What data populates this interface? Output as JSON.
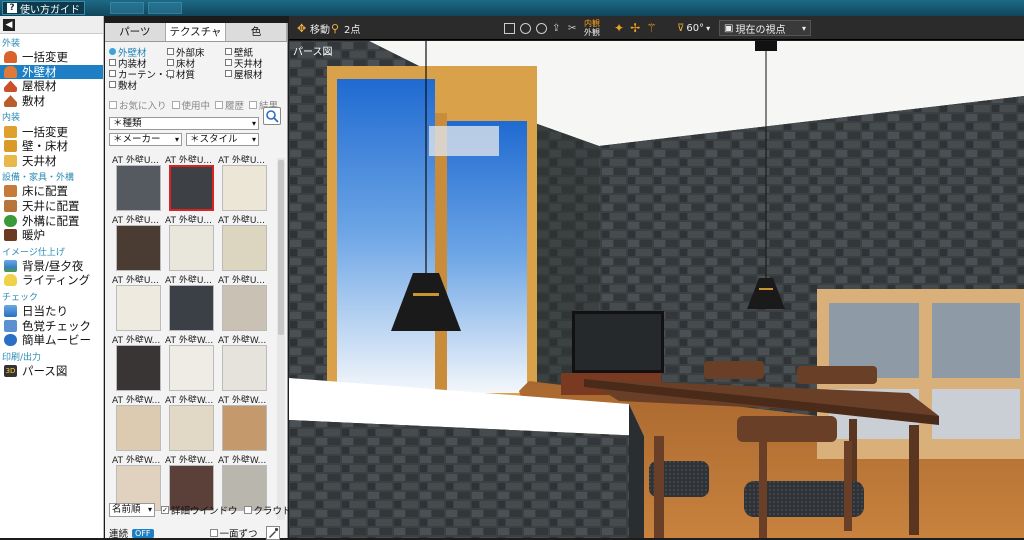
{
  "titlebar": {
    "guide_button": "使い方ガイド"
  },
  "sidebar": {
    "sections": {
      "exterior": "外装",
      "interior": "内装",
      "equipment": "設備・家具・外構",
      "image_finish": "イメージ仕上げ",
      "check": "チェック",
      "print": "印刷/出力"
    },
    "items": [
      {
        "label": "一括変更",
        "icon": "house-bulk-icon",
        "color": "#d9632b"
      },
      {
        "label": "外壁材",
        "icon": "exterior-wall-icon",
        "color": "#d9632b"
      },
      {
        "label": "屋根材",
        "icon": "roof-icon",
        "color": "#d9632b"
      },
      {
        "label": "敷材",
        "icon": "ground-material-icon",
        "color": "#d9632b"
      },
      {
        "label": "一括変更",
        "icon": "interior-bulk-icon",
        "color": "#e0a030"
      },
      {
        "label": "壁・床材",
        "icon": "wall-floor-icon",
        "color": "#e0a030"
      },
      {
        "label": "天井材",
        "icon": "ceiling-icon",
        "color": "#e0a030"
      },
      {
        "label": "床に配置",
        "icon": "chair-icon",
        "color": "#c77b3a"
      },
      {
        "label": "天井に配置",
        "icon": "lamp-icon",
        "color": "#c77b3a"
      },
      {
        "label": "外構に配置",
        "icon": "tree-icon",
        "color": "#3a9a3a"
      },
      {
        "label": "暖炉",
        "icon": "fireplace-icon",
        "color": "#8a4a2a"
      },
      {
        "label": "背景/昼夕夜",
        "icon": "background-icon",
        "color": "#3a7fc4"
      },
      {
        "label": "ライティング",
        "icon": "bulb-icon",
        "color": "#e6c12e"
      },
      {
        "label": "日当たり",
        "icon": "sun-icon",
        "color": "#3a7fc4"
      },
      {
        "label": "色覚チェック",
        "icon": "person-icon",
        "color": "#3a7fc4"
      },
      {
        "label": "簡単ムービー",
        "icon": "play-icon",
        "color": "#2a6fc4"
      },
      {
        "label": "パース図",
        "icon": "perspective-icon",
        "color": "#2a2a2a"
      }
    ]
  },
  "material_panel": {
    "tabs": [
      "パーツ",
      "テクスチャ",
      "色"
    ],
    "categories": [
      {
        "label": "外壁材",
        "active": true
      },
      {
        "label": "外部床",
        "active": false
      },
      {
        "label": "壁紙",
        "active": false
      },
      {
        "label": "内装材",
        "active": false
      },
      {
        "label": "床材",
        "active": false
      },
      {
        "label": "天井材",
        "active": false
      },
      {
        "label": "カーテン・布",
        "active": false
      },
      {
        "label": "材質",
        "active": false
      },
      {
        "label": "屋根材",
        "active": false
      },
      {
        "label": "敷材",
        "active": false
      }
    ],
    "filters": [
      "お気に入り",
      "使用中",
      "履歴",
      "結果"
    ],
    "kind_select": "＊種類",
    "maker_select": "＊メーカー",
    "style_select": "＊スタイル",
    "swatches": [
      {
        "label": "AT 外壁U...",
        "color": "#555a60",
        "selected": false
      },
      {
        "label": "AT 外壁U...",
        "color": "#3d4044",
        "selected": true
      },
      {
        "label": "AT 外壁U...",
        "color": "#ece6d6",
        "selected": false
      },
      {
        "label": "AT 外壁U...",
        "color": "#4a3c33",
        "selected": false
      },
      {
        "label": "AT 外壁U...",
        "color": "#e9e6dc",
        "selected": false
      },
      {
        "label": "AT 外壁U...",
        "color": "#dcd5c0",
        "selected": false
      },
      {
        "label": "AT 外壁U...",
        "color": "#eeeae0",
        "selected": false
      },
      {
        "label": "AT 外壁U...",
        "color": "#3b3f46",
        "selected": false
      },
      {
        "label": "AT 外壁U...",
        "color": "#c9c2b4",
        "selected": false
      },
      {
        "label": "AT 外壁W...",
        "color": "#3a3535",
        "selected": false
      },
      {
        "label": "AT 外壁W...",
        "color": "#efece6",
        "selected": false
      },
      {
        "label": "AT 外壁W...",
        "color": "#e6e3dc",
        "selected": false
      },
      {
        "label": "AT 外壁W...",
        "color": "#dccbb0",
        "selected": false
      },
      {
        "label": "AT 外壁W...",
        "color": "#e2d8c6",
        "selected": false
      },
      {
        "label": "AT 外壁W...",
        "color": "#c49a6c",
        "selected": false
      },
      {
        "label": "AT 外壁W...",
        "color": "#e0d2be",
        "selected": false
      },
      {
        "label": "AT 外壁W...",
        "color": "#5a4038",
        "selected": false
      },
      {
        "label": "AT 外壁W...",
        "color": "#b9b6ae",
        "selected": false
      }
    ],
    "sort_select": "名前順",
    "detail_window": "詳細ウインドウ",
    "cloud_material": "クラウド素材",
    "link_label": "連続",
    "link_toggle": "OFF",
    "one_side": "一面ずつ"
  },
  "view_toolbar": {
    "move": "移動",
    "two_point": "2点",
    "inside_outside_top": "内観",
    "inside_outside_bottom": "外観",
    "angle": "60°",
    "viewpoint": "現在の視点"
  },
  "view": {
    "label": "パース図"
  }
}
